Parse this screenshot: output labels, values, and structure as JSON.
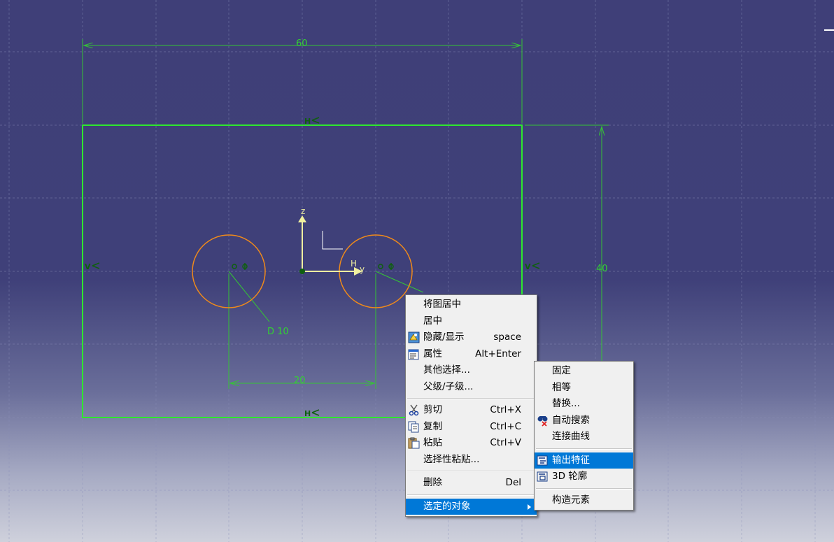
{
  "sketch": {
    "dim_width": "60",
    "dim_height": "40",
    "dim_spacing": "20",
    "dim_diameter": "D 10",
    "constraint_h": "H",
    "constraint_v": "V",
    "axis_v": "z",
    "axis_h": "y",
    "axis_h_label": "H",
    "colors": {
      "geometry": "#2ee82e",
      "circle": "#f08a1a",
      "dimension": "#35c435",
      "grid": "#8a8fb8",
      "axis": "#f0f0a0"
    }
  },
  "context_menu": {
    "items": [
      {
        "label": "将图居中",
        "shortcut": "",
        "icon": ""
      },
      {
        "label": "居中",
        "shortcut": "",
        "icon": ""
      },
      {
        "label": "隐藏/显示",
        "shortcut": "space",
        "icon": "hide-show-icon"
      },
      {
        "label": "属性",
        "shortcut": "Alt+Enter",
        "icon": "properties-icon"
      },
      {
        "label": "其他选择...",
        "shortcut": "",
        "icon": ""
      },
      {
        "label": "父级/子级...",
        "shortcut": "",
        "icon": ""
      },
      {
        "label": "剪切",
        "shortcut": "Ctrl+X",
        "icon": "scissors-icon"
      },
      {
        "label": "复制",
        "shortcut": "Ctrl+C",
        "icon": "copy-icon"
      },
      {
        "label": "粘贴",
        "shortcut": "Ctrl+V",
        "icon": "paste-icon"
      },
      {
        "label": "选择性粘贴...",
        "shortcut": "",
        "icon": ""
      },
      {
        "label": "删除",
        "shortcut": "Del",
        "icon": ""
      },
      {
        "label": "选定的对象",
        "shortcut": "",
        "icon": ""
      }
    ]
  },
  "sub_menu": {
    "items": [
      {
        "label": "固定",
        "icon": ""
      },
      {
        "label": "相等",
        "icon": ""
      },
      {
        "label": "替换...",
        "icon": ""
      },
      {
        "label": "自动搜索",
        "icon": "auto-search-icon"
      },
      {
        "label": "连接曲线",
        "icon": ""
      },
      {
        "label": "输出特征",
        "icon": "output-feature-icon"
      },
      {
        "label": "3D 轮廓",
        "icon": "3d-profile-icon"
      },
      {
        "label": "构造元素",
        "icon": ""
      }
    ]
  }
}
